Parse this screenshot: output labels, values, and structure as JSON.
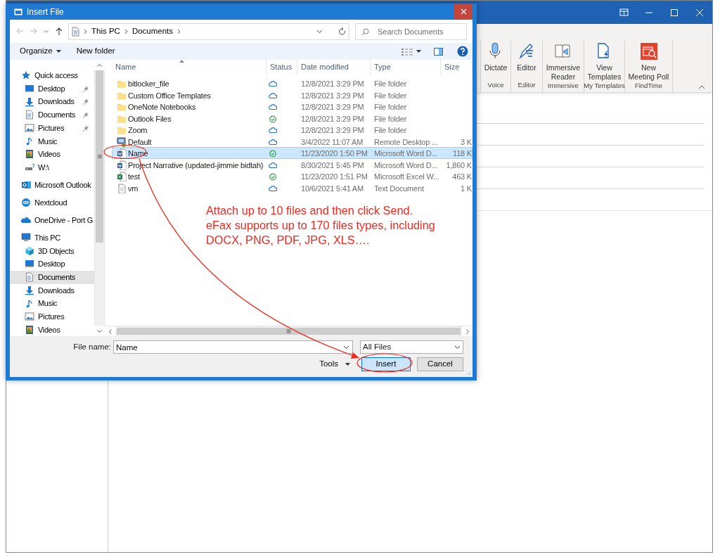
{
  "app_window": {
    "ribbon": {
      "groups": [
        {
          "label": "Voice",
          "button": {
            "lines": [
              "Dictate"
            ]
          }
        },
        {
          "label": "Editor",
          "button": {
            "lines": [
              "Editor"
            ]
          }
        },
        {
          "label": "Immersive",
          "button": {
            "lines": [
              "Immersive",
              "Reader"
            ]
          }
        },
        {
          "label": "My Templates",
          "button": {
            "lines": [
              "View",
              "Templates"
            ]
          }
        },
        {
          "label": "FindTime",
          "button": {
            "lines": [
              "New",
              "Meeting Poll"
            ]
          }
        }
      ]
    }
  },
  "dialog": {
    "title": "Insert File",
    "address": {
      "crumbs": [
        "This PC",
        "Documents"
      ]
    },
    "search": {
      "placeholder": "Search Documents"
    },
    "toolbar": {
      "organize": "Organize",
      "new_folder": "New folder"
    },
    "nav": [
      {
        "label": "Quick access",
        "selected": false,
        "children": [
          {
            "label": "Desktop",
            "selected": false,
            "pinned": true
          },
          {
            "label": "Downloads",
            "selected": false,
            "pinned": true
          },
          {
            "label": "Documents",
            "selected": false,
            "pinned": true
          },
          {
            "label": "Pictures",
            "selected": false,
            "pinned": true
          },
          {
            "label": "Music",
            "selected": false,
            "pinned": false
          },
          {
            "label": "Videos",
            "selected": false,
            "pinned": false
          },
          {
            "label": "W:\\",
            "selected": false,
            "pinned": false
          }
        ]
      },
      {
        "label": "Microsoft Outlook",
        "selected": false
      },
      {
        "label": "Nextcloud",
        "selected": false
      },
      {
        "label": "OneDrive - Port G",
        "selected": false
      },
      {
        "label": "This PC",
        "selected": false,
        "children": [
          {
            "label": "3D Objects",
            "selected": false
          },
          {
            "label": "Desktop",
            "selected": false
          },
          {
            "label": "Documents",
            "selected": true
          },
          {
            "label": "Downloads",
            "selected": false
          },
          {
            "label": "Music",
            "selected": false
          },
          {
            "label": "Pictures",
            "selected": false
          },
          {
            "label": "Videos",
            "selected": false
          }
        ]
      }
    ],
    "columns": [
      "Name",
      "Status",
      "Date modified",
      "Type",
      "Size"
    ],
    "files": [
      {
        "name": "bitlocker_file",
        "kind": "folder",
        "synced": false,
        "date": "12/8/2021 3:29 PM",
        "type": "File folder",
        "selected": false
      },
      {
        "name": "Custom Office Templates",
        "kind": "folder",
        "synced": false,
        "date": "12/8/2021 3:29 PM",
        "type": "File folder",
        "selected": false
      },
      {
        "name": "OneNote Notebooks",
        "kind": "folder",
        "synced": false,
        "date": "12/8/2021 3:29 PM",
        "type": "File folder",
        "selected": false
      },
      {
        "name": "Outlook Files",
        "kind": "folder",
        "synced": true,
        "date": "12/8/2021 3:29 PM",
        "type": "File folder",
        "selected": false
      },
      {
        "name": "Zoom",
        "kind": "folder",
        "synced": false,
        "date": "12/8/2021 3:29 PM",
        "type": "File folder",
        "selected": false
      },
      {
        "name": "Default",
        "kind": "remote",
        "synced": false,
        "date": "3/4/2022 11:07 AM",
        "type": "Remote Desktop ...",
        "size": "3 K",
        "selected": false
      },
      {
        "name": "Name",
        "kind": "word",
        "synced": true,
        "date": "11/23/2020 1:50 PM",
        "type": "Microsoft Word D...",
        "size": "118 K",
        "selected": true
      },
      {
        "name": "Project Narrative (updated-jimmie bidtah)",
        "kind": "word",
        "synced": false,
        "date": "8/30/2021 5:45 PM",
        "type": "Microsoft Word D...",
        "size": "1,860 K",
        "selected": false
      },
      {
        "name": "test",
        "kind": "excel",
        "synced": true,
        "date": "11/23/2020 1:51 PM",
        "type": "Microsoft Excel W...",
        "size": "463 K",
        "selected": false
      },
      {
        "name": "vm",
        "kind": "text",
        "synced": false,
        "date": "10/6/2021 5:41 AM",
        "type": "Text Document",
        "size": "1 K",
        "selected": false
      }
    ],
    "file_name": {
      "label": "File name:",
      "value": "Name"
    },
    "filter": "All Files",
    "tools": "Tools",
    "buttons": [
      {
        "label": "Insert",
        "default": true
      },
      {
        "label": "Cancel",
        "default": false
      }
    ]
  },
  "annotation": {
    "lines": [
      "Attach up to 10 files and then click Send.",
      "eFax supports up to 170 files types, including",
      "DOCX, PNG, PDF, JPG, XLS…."
    ]
  }
}
